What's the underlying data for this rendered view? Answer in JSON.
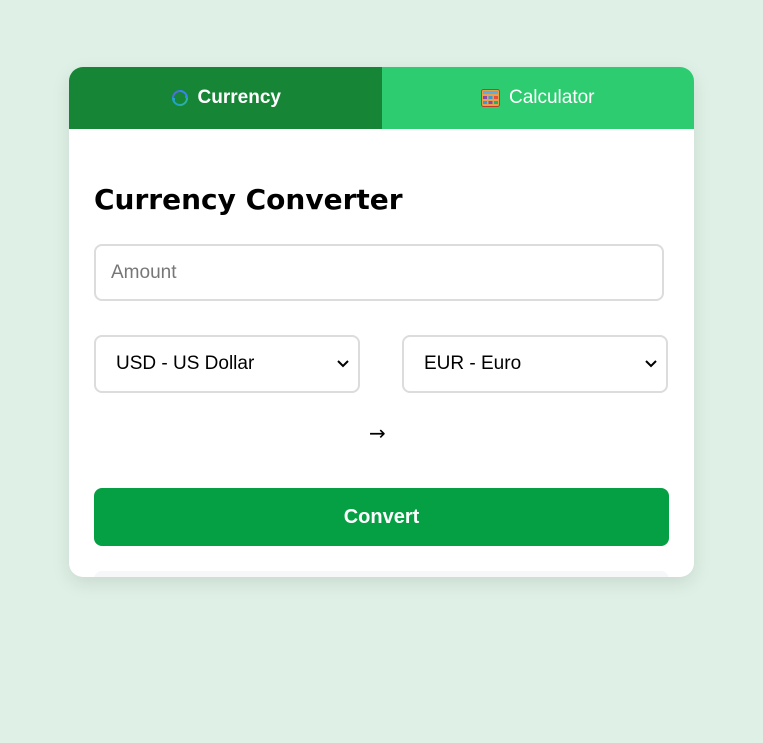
{
  "tabs": {
    "currency": {
      "label": "Currency",
      "icon": "currency-exchange-icon",
      "active": true
    },
    "calculator": {
      "label": "Calculator",
      "icon": "calculator-icon",
      "active": false
    }
  },
  "converter": {
    "title": "Currency Converter",
    "amount_placeholder": "Amount",
    "amount_value": "",
    "from_currency": "USD - US Dollar",
    "arrow": "→",
    "to_currency": "EUR - Euro",
    "convert_label": "Convert",
    "result": ""
  },
  "colors": {
    "page_background": "#dff1e6",
    "active_tab": "#168536",
    "inactive_tab": "#2ecc71",
    "convert_button": "#05a043",
    "result_accent": "#2ecc71"
  }
}
